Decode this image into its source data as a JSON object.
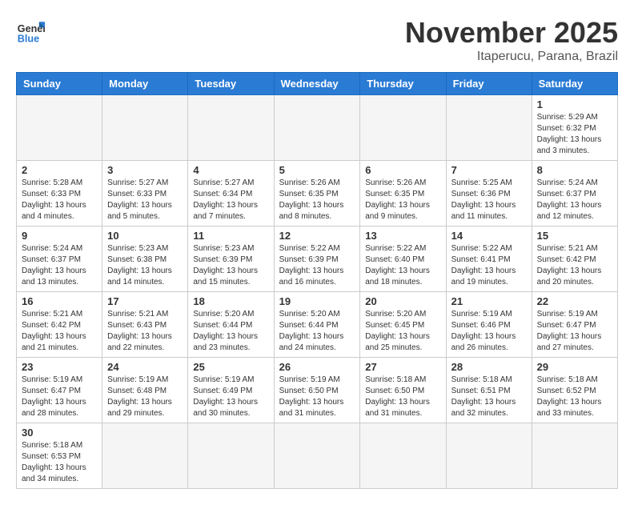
{
  "header": {
    "logo_general": "General",
    "logo_blue": "Blue",
    "month_title": "November 2025",
    "location": "Itaperucu, Parana, Brazil"
  },
  "weekdays": [
    "Sunday",
    "Monday",
    "Tuesday",
    "Wednesday",
    "Thursday",
    "Friday",
    "Saturday"
  ],
  "weeks": [
    [
      {
        "day": "",
        "info": ""
      },
      {
        "day": "",
        "info": ""
      },
      {
        "day": "",
        "info": ""
      },
      {
        "day": "",
        "info": ""
      },
      {
        "day": "",
        "info": ""
      },
      {
        "day": "",
        "info": ""
      },
      {
        "day": "1",
        "info": "Sunrise: 5:29 AM\nSunset: 6:32 PM\nDaylight: 13 hours and 3 minutes."
      }
    ],
    [
      {
        "day": "2",
        "info": "Sunrise: 5:28 AM\nSunset: 6:33 PM\nDaylight: 13 hours and 4 minutes."
      },
      {
        "day": "3",
        "info": "Sunrise: 5:27 AM\nSunset: 6:33 PM\nDaylight: 13 hours and 5 minutes."
      },
      {
        "day": "4",
        "info": "Sunrise: 5:27 AM\nSunset: 6:34 PM\nDaylight: 13 hours and 7 minutes."
      },
      {
        "day": "5",
        "info": "Sunrise: 5:26 AM\nSunset: 6:35 PM\nDaylight: 13 hours and 8 minutes."
      },
      {
        "day": "6",
        "info": "Sunrise: 5:26 AM\nSunset: 6:35 PM\nDaylight: 13 hours and 9 minutes."
      },
      {
        "day": "7",
        "info": "Sunrise: 5:25 AM\nSunset: 6:36 PM\nDaylight: 13 hours and 11 minutes."
      },
      {
        "day": "8",
        "info": "Sunrise: 5:24 AM\nSunset: 6:37 PM\nDaylight: 13 hours and 12 minutes."
      }
    ],
    [
      {
        "day": "9",
        "info": "Sunrise: 5:24 AM\nSunset: 6:37 PM\nDaylight: 13 hours and 13 minutes."
      },
      {
        "day": "10",
        "info": "Sunrise: 5:23 AM\nSunset: 6:38 PM\nDaylight: 13 hours and 14 minutes."
      },
      {
        "day": "11",
        "info": "Sunrise: 5:23 AM\nSunset: 6:39 PM\nDaylight: 13 hours and 15 minutes."
      },
      {
        "day": "12",
        "info": "Sunrise: 5:22 AM\nSunset: 6:39 PM\nDaylight: 13 hours and 16 minutes."
      },
      {
        "day": "13",
        "info": "Sunrise: 5:22 AM\nSunset: 6:40 PM\nDaylight: 13 hours and 18 minutes."
      },
      {
        "day": "14",
        "info": "Sunrise: 5:22 AM\nSunset: 6:41 PM\nDaylight: 13 hours and 19 minutes."
      },
      {
        "day": "15",
        "info": "Sunrise: 5:21 AM\nSunset: 6:42 PM\nDaylight: 13 hours and 20 minutes."
      }
    ],
    [
      {
        "day": "16",
        "info": "Sunrise: 5:21 AM\nSunset: 6:42 PM\nDaylight: 13 hours and 21 minutes."
      },
      {
        "day": "17",
        "info": "Sunrise: 5:21 AM\nSunset: 6:43 PM\nDaylight: 13 hours and 22 minutes."
      },
      {
        "day": "18",
        "info": "Sunrise: 5:20 AM\nSunset: 6:44 PM\nDaylight: 13 hours and 23 minutes."
      },
      {
        "day": "19",
        "info": "Sunrise: 5:20 AM\nSunset: 6:44 PM\nDaylight: 13 hours and 24 minutes."
      },
      {
        "day": "20",
        "info": "Sunrise: 5:20 AM\nSunset: 6:45 PM\nDaylight: 13 hours and 25 minutes."
      },
      {
        "day": "21",
        "info": "Sunrise: 5:19 AM\nSunset: 6:46 PM\nDaylight: 13 hours and 26 minutes."
      },
      {
        "day": "22",
        "info": "Sunrise: 5:19 AM\nSunset: 6:47 PM\nDaylight: 13 hours and 27 minutes."
      }
    ],
    [
      {
        "day": "23",
        "info": "Sunrise: 5:19 AM\nSunset: 6:47 PM\nDaylight: 13 hours and 28 minutes."
      },
      {
        "day": "24",
        "info": "Sunrise: 5:19 AM\nSunset: 6:48 PM\nDaylight: 13 hours and 29 minutes."
      },
      {
        "day": "25",
        "info": "Sunrise: 5:19 AM\nSunset: 6:49 PM\nDaylight: 13 hours and 30 minutes."
      },
      {
        "day": "26",
        "info": "Sunrise: 5:19 AM\nSunset: 6:50 PM\nDaylight: 13 hours and 31 minutes."
      },
      {
        "day": "27",
        "info": "Sunrise: 5:18 AM\nSunset: 6:50 PM\nDaylight: 13 hours and 31 minutes."
      },
      {
        "day": "28",
        "info": "Sunrise: 5:18 AM\nSunset: 6:51 PM\nDaylight: 13 hours and 32 minutes."
      },
      {
        "day": "29",
        "info": "Sunrise: 5:18 AM\nSunset: 6:52 PM\nDaylight: 13 hours and 33 minutes."
      }
    ],
    [
      {
        "day": "30",
        "info": "Sunrise: 5:18 AM\nSunset: 6:53 PM\nDaylight: 13 hours and 34 minutes."
      },
      {
        "day": "",
        "info": ""
      },
      {
        "day": "",
        "info": ""
      },
      {
        "day": "",
        "info": ""
      },
      {
        "day": "",
        "info": ""
      },
      {
        "day": "",
        "info": ""
      },
      {
        "day": "",
        "info": ""
      }
    ]
  ]
}
